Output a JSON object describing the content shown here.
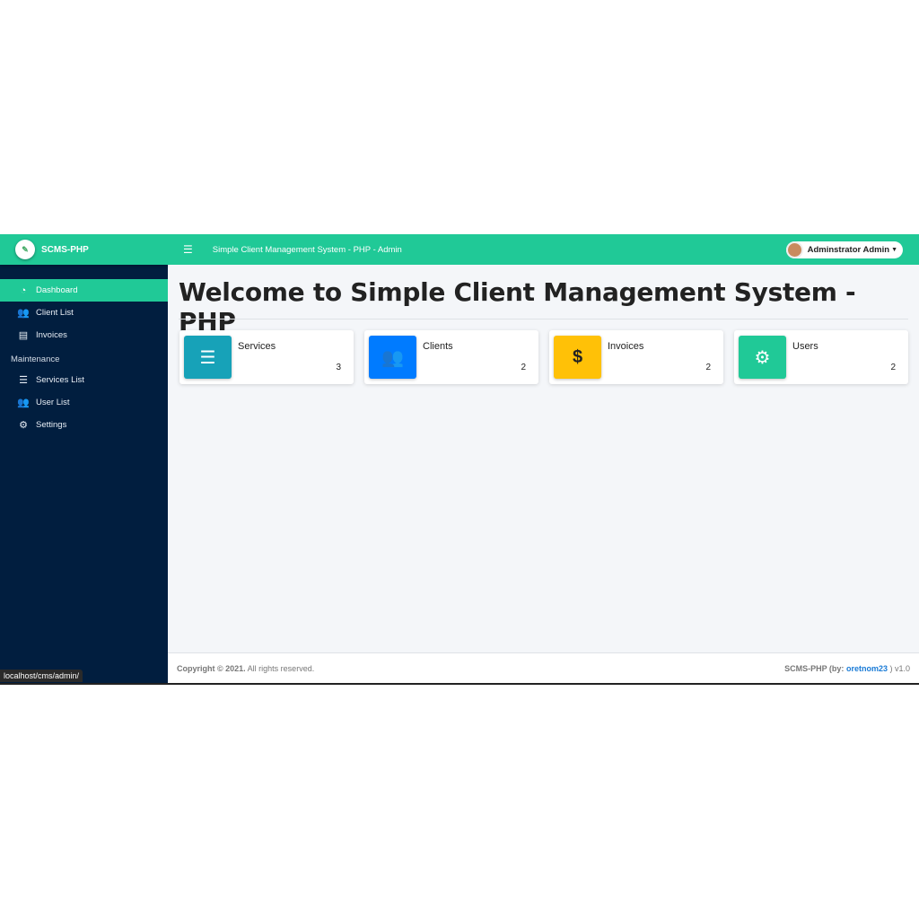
{
  "brand": "SCMS-PHP",
  "sidebar": {
    "items": [
      {
        "label": "Dashboard",
        "icon": "tachometer-icon",
        "glyph": "◔",
        "active": true
      },
      {
        "label": "Client List",
        "icon": "users-icon",
        "glyph": "👥"
      },
      {
        "label": "Invoices",
        "icon": "file-invoice-icon",
        "glyph": "▤"
      }
    ],
    "section": "Maintenance",
    "maintenance": [
      {
        "label": "Services List",
        "icon": "list-icon",
        "glyph": "☰"
      },
      {
        "label": "User List",
        "icon": "users-cog-icon",
        "glyph": "👥"
      },
      {
        "label": "Settings",
        "icon": "cogs-icon",
        "glyph": "⚙"
      }
    ]
  },
  "topbar": {
    "title": "Simple Client Management System - PHP - Admin",
    "user": "Adminstrator Admin"
  },
  "page": {
    "title": "Welcome to Simple Client Management System - PHP"
  },
  "cards": [
    {
      "label": "Services",
      "value": "3",
      "color": "#17a2b8",
      "glyph": "☰"
    },
    {
      "label": "Clients",
      "value": "2",
      "color": "#007bff",
      "glyph": "👥"
    },
    {
      "label": "Invoices",
      "value": "2",
      "color": "#ffc107",
      "glyph": "$"
    },
    {
      "label": "Users",
      "value": "2",
      "color": "#20c997",
      "glyph": "⚙"
    }
  ],
  "footer": {
    "copyright": "Copyright © 2021.",
    "rights": "All rights reserved.",
    "credit_prefix": "SCMS-PHP (by:",
    "author": "oretnom23",
    "credit_suffix": ") v1.0"
  },
  "status_url": "localhost/cms/admin/"
}
